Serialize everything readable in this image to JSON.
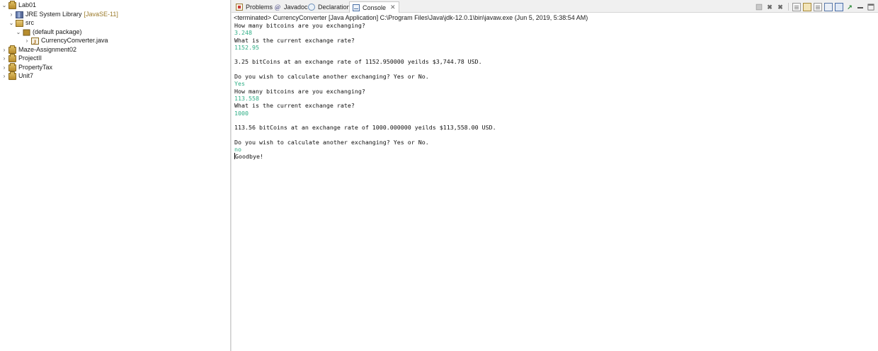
{
  "explorer": {
    "items": [
      {
        "label": "Lab01",
        "expanded": true,
        "icon": "project-icon",
        "decoration": ""
      },
      {
        "label": "JRE System Library",
        "expanded": false,
        "icon": "library-icon",
        "decoration": "[JavaSE-11]"
      },
      {
        "label": "src",
        "expanded": true,
        "icon": "source-folder-icon",
        "decoration": ""
      },
      {
        "label": "(default package)",
        "expanded": true,
        "icon": "package-icon",
        "decoration": ""
      },
      {
        "label": "CurrencyConverter.java",
        "expanded": false,
        "icon": "java-file-icon",
        "decoration": ""
      },
      {
        "label": "Maze-Assignment02",
        "expanded": false,
        "icon": "project-icon",
        "decoration": ""
      },
      {
        "label": "ProjectII",
        "expanded": false,
        "icon": "project-icon",
        "decoration": ""
      },
      {
        "label": "PropertyTax",
        "expanded": false,
        "icon": "project-icon",
        "decoration": ""
      },
      {
        "label": "Unit7",
        "expanded": false,
        "icon": "project-icon",
        "decoration": ""
      }
    ]
  },
  "tabs": [
    {
      "label": "Problems",
      "icon": "problems-icon",
      "active": false
    },
    {
      "label": "Javadoc",
      "icon": "javadoc-icon",
      "active": false
    },
    {
      "label": "Declaration",
      "icon": "declaration-icon",
      "active": false
    },
    {
      "label": "Console",
      "icon": "console-icon",
      "active": true,
      "close": "✕"
    }
  ],
  "console": {
    "status": "<terminated> CurrencyConverter [Java Application] C:\\Program Files\\Java\\jdk-12.0.1\\bin\\javaw.exe (Jun 5, 2019, 5:38:54 AM)",
    "lines": [
      {
        "text": "How many bitcoins are you exchanging?",
        "kind": "output"
      },
      {
        "text": "3.248",
        "kind": "input"
      },
      {
        "text": "What is the current exchange rate?",
        "kind": "output"
      },
      {
        "text": "1152.95",
        "kind": "input"
      },
      {
        "text": "",
        "kind": "output"
      },
      {
        "text": "3.25 bitCoins at an exchange rate of 1152.950000 yeilds $3,744.78 USD.",
        "kind": "output"
      },
      {
        "text": "",
        "kind": "output"
      },
      {
        "text": "Do you wish to calculate another exchanging? Yes or No.",
        "kind": "output"
      },
      {
        "text": "Yes",
        "kind": "input"
      },
      {
        "text": "How many bitcoins are you exchanging?",
        "kind": "output"
      },
      {
        "text": "113.558",
        "kind": "input"
      },
      {
        "text": "What is the current exchange rate?",
        "kind": "output"
      },
      {
        "text": "1000",
        "kind": "input"
      },
      {
        "text": "",
        "kind": "output"
      },
      {
        "text": "113.56 bitCoins at an exchange rate of 1000.000000 yeilds $113,558.00 USD.",
        "kind": "output"
      },
      {
        "text": "",
        "kind": "output"
      },
      {
        "text": "Do you wish to calculate another exchanging? Yes or No.",
        "kind": "output"
      },
      {
        "text": "no",
        "kind": "input"
      },
      {
        "text": "Goodbye!",
        "kind": "output"
      }
    ]
  },
  "colors": {
    "input_text": "#2fae86",
    "output_text": "#111111",
    "decoration": "#9b7a2a"
  }
}
